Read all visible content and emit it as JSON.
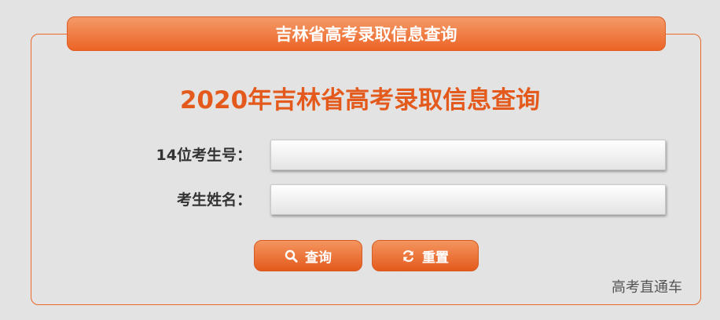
{
  "header": {
    "title": "吉林省高考录取信息查询"
  },
  "main": {
    "title": "2020年吉林省高考录取信息查询"
  },
  "form": {
    "exam_number_label": "14位考生号：",
    "exam_number_value": "",
    "exam_number_placeholder": "",
    "name_label": "考生姓名：",
    "name_value": "",
    "name_placeholder": ""
  },
  "buttons": {
    "query_label": "查询",
    "query_icon": "search-icon",
    "reset_label": "重置",
    "reset_icon": "refresh-icon"
  },
  "watermark": {
    "text": "高考直通车"
  },
  "colors": {
    "accent": "#e8692a",
    "title_text": "#e45a1c",
    "background": "#e3e3e3"
  }
}
